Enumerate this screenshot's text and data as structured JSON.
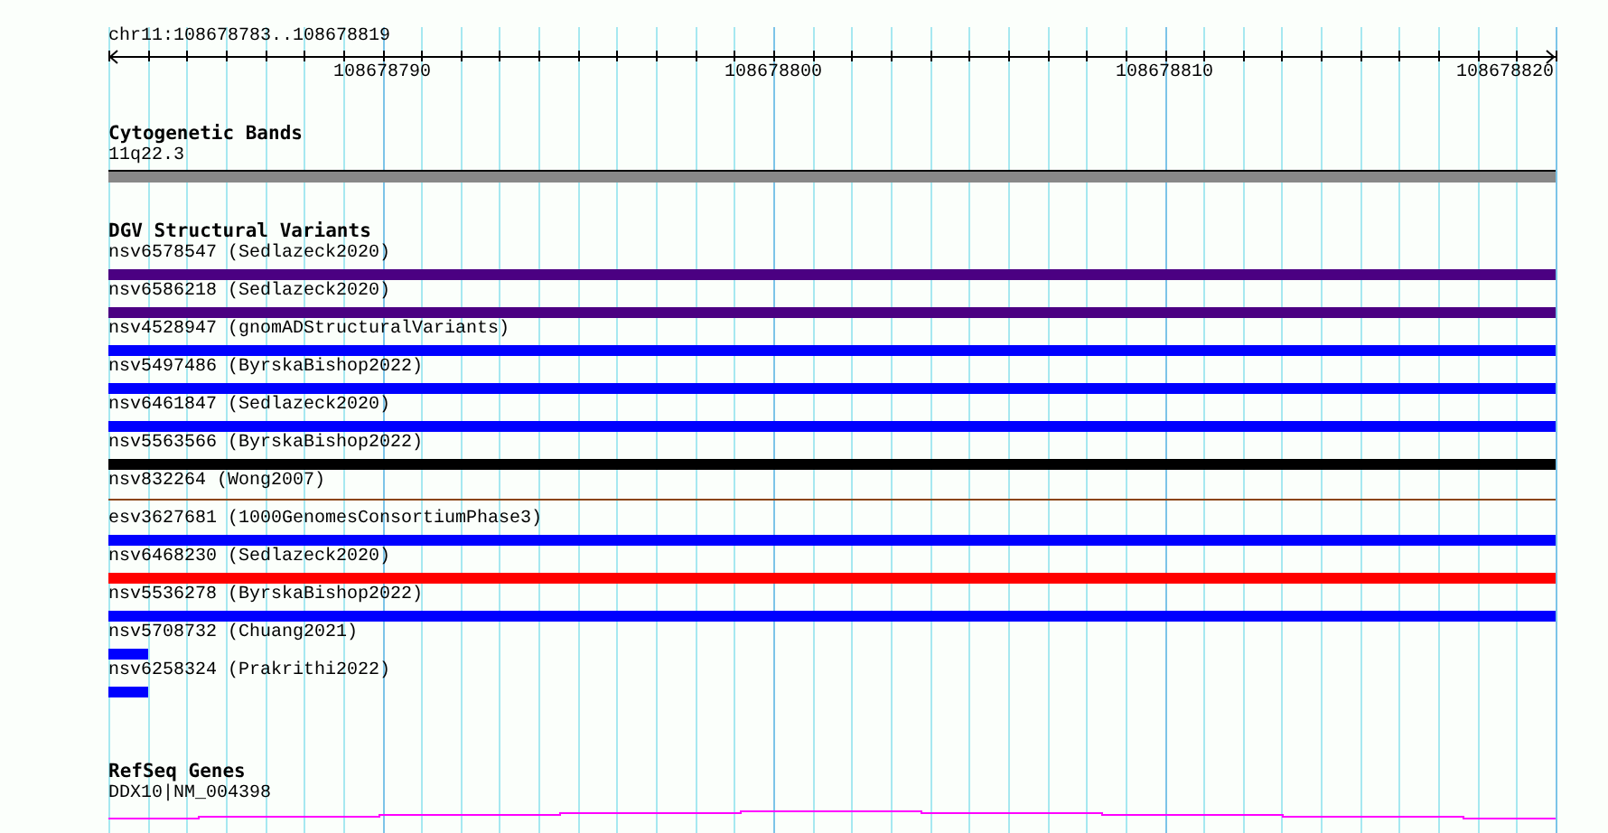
{
  "location": "chr11:108678783..108678819",
  "ruler": {
    "labels": [
      "108678790",
      "108678800",
      "108678810",
      "108678820"
    ]
  },
  "cytogenetic_bands": {
    "title": "Cytogenetic Bands",
    "band": "11q22.3"
  },
  "dgv": {
    "title": "DGV Structural Variants",
    "variants": [
      {
        "label": "nsv6578547 (Sedlazeck2020)",
        "kind": "full",
        "color": "#4b0082"
      },
      {
        "label": "nsv6586218 (Sedlazeck2020)",
        "kind": "full",
        "color": "#4b0082"
      },
      {
        "label": "nsv4528947 (gnomADStructuralVariants)",
        "kind": "full",
        "color": "#0000ff"
      },
      {
        "label": "nsv5497486 (ByrskaBishop2022)",
        "kind": "full",
        "color": "#0000ff"
      },
      {
        "label": "nsv6461847 (Sedlazeck2020)",
        "kind": "full",
        "color": "#0000ff"
      },
      {
        "label": "nsv5563566 (ByrskaBishop2022)",
        "kind": "full",
        "color": "#000000"
      },
      {
        "label": "nsv832264 (Wong2007)",
        "kind": "line",
        "color": "#8b4513"
      },
      {
        "label": "esv3627681 (1000GenomesConsortiumPhase3)",
        "kind": "full",
        "color": "#0000ff"
      },
      {
        "label": "nsv6468230 (Sedlazeck2020)",
        "kind": "full",
        "color": "#ff0000"
      },
      {
        "label": "nsv5536278 (ByrskaBishop2022)",
        "kind": "full",
        "color": "#0000ff"
      },
      {
        "label": "nsv5708732 (Chuang2021)",
        "kind": "short",
        "color": "#0000ff"
      },
      {
        "label": "nsv6258324 (Prakrithi2022)",
        "kind": "short",
        "color": "#0000ff"
      }
    ]
  },
  "refseq": {
    "title": "RefSeq Genes",
    "gene": "DDX10|NM_004398"
  }
}
